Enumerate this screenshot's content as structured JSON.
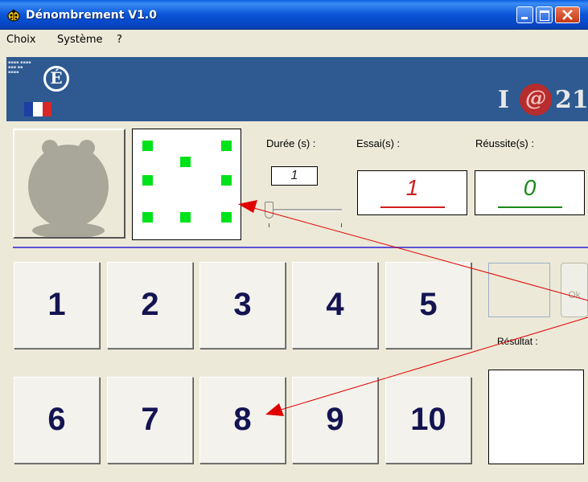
{
  "window": {
    "title": "Dénombrement V1.0"
  },
  "menu": [
    "Choix",
    "Système",
    "?"
  ],
  "banner": {
    "logo_letter": "É",
    "brand_left": "I",
    "brand_mid": "@",
    "brand_right": "21",
    "flag_colors": [
      "#1d3fa3",
      "#ffffff",
      "#d62828"
    ]
  },
  "labels": {
    "duree": "Durée (s) :",
    "essais": "Essai(s) :",
    "reussites": "Réussite(s) :",
    "resultat": "Résultat :"
  },
  "values": {
    "duree": "1",
    "essais": "1",
    "reussites": "0"
  },
  "number_buttons": [
    "1",
    "2",
    "3",
    "4",
    "5",
    "6",
    "7",
    "8",
    "9",
    "10"
  ],
  "ok_label": "Ok",
  "colors": {
    "dot": "#00e21a",
    "essai_value": "#d11d1d",
    "reussite_value": "#1a8a1a",
    "separator": "#5b52d6",
    "annotation_arrow": "#e00000"
  }
}
